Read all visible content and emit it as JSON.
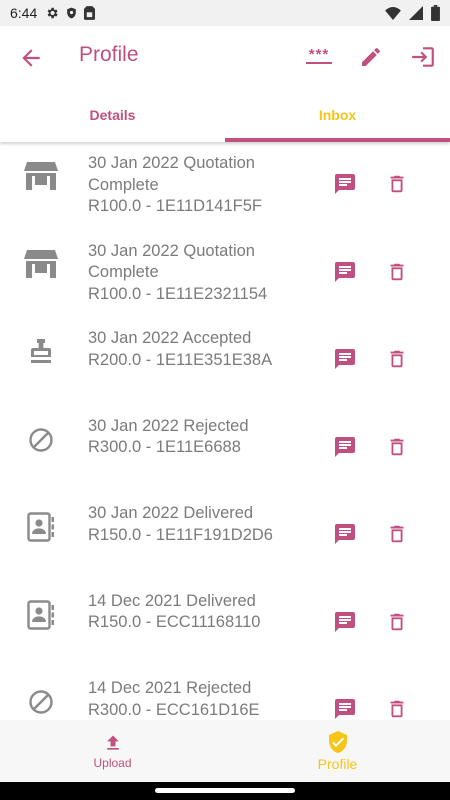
{
  "status_bar": {
    "time": "6:44"
  },
  "app_bar": {
    "title": "Profile",
    "password_stars": "***"
  },
  "tabs": [
    {
      "label": "Details",
      "selected": false
    },
    {
      "label": "Inbox",
      "selected": true
    }
  ],
  "inbox": {
    "items": [
      {
        "icon": "store-icon",
        "line1": "30 Jan 2022 Quotation Complete",
        "line2": "R100.0 - 1E11D141F5F"
      },
      {
        "icon": "store-icon",
        "line1": "30 Jan 2022 Quotation Complete",
        "line2": "R100.0 - 1E11E2321154"
      },
      {
        "icon": "stamp-icon",
        "line1": "30 Jan 2022 Accepted",
        "line2": "R200.0 - 1E11E351E38A"
      },
      {
        "icon": "block-icon",
        "line1": "30 Jan 2022 Rejected",
        "line2": "R300.0 - 1E11E6688"
      },
      {
        "icon": "contact-card-icon",
        "line1": "30 Jan 2022 Delivered",
        "line2": "R150.0 - 1E11F191D2D6"
      },
      {
        "icon": "contact-card-icon",
        "line1": "14 Dec 2021 Delivered",
        "line2": "R150.0 - ECC11168110"
      },
      {
        "icon": "block-icon",
        "line1": "14 Dec 2021 Rejected",
        "line2": "R300.0 - ECC161D16E"
      }
    ]
  },
  "bottom_nav": {
    "upload_label": "Upload",
    "profile_label": "Profile"
  },
  "colors": {
    "primary": "#c0507f",
    "accent": "#f5c518",
    "text_secondary": "#7b7b7b",
    "icon_grey": "#8a8a8a"
  }
}
